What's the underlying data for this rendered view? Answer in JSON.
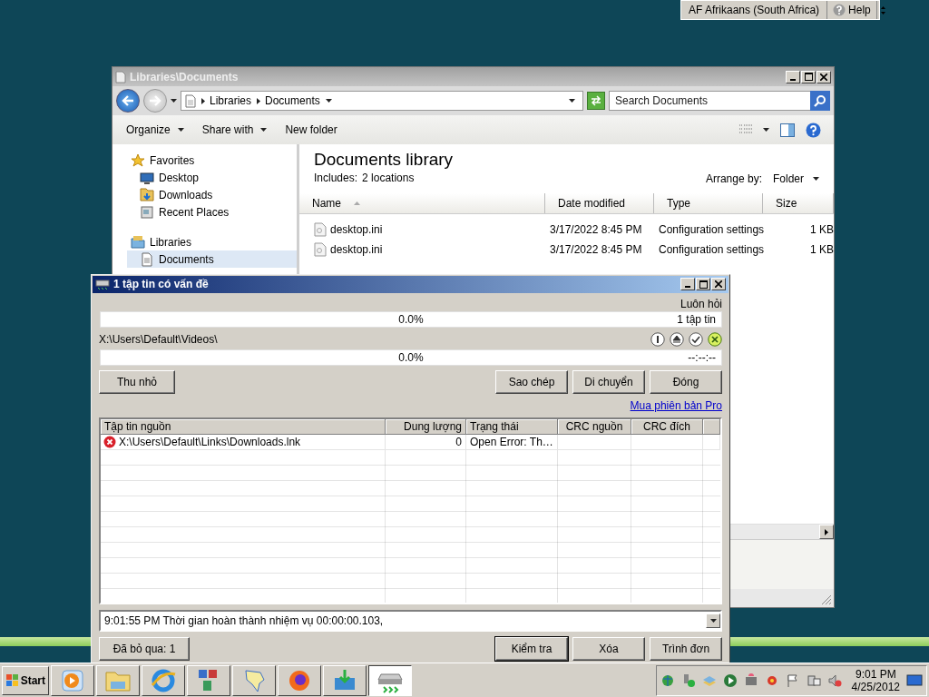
{
  "language_bar": {
    "language": "AF Afrikaans (South Africa)",
    "help": "Help"
  },
  "explorer": {
    "title": "Libraries\\Documents",
    "breadcrumbs": [
      "Libraries",
      "Documents"
    ],
    "search": {
      "placeholder": "Search Documents"
    },
    "toolbar": [
      {
        "label": "Organize",
        "dropdown": true
      },
      {
        "label": "Share with",
        "dropdown": true
      },
      {
        "label": "New folder",
        "dropdown": false
      }
    ],
    "nav": [
      {
        "label": "Favorites",
        "selected": false,
        "children": [
          {
            "label": "Desktop",
            "selected": false
          },
          {
            "label": "Downloads",
            "selected": false
          },
          {
            "label": "Recent Places",
            "selected": false
          }
        ]
      },
      {
        "label": "Libraries",
        "selected": false,
        "children": [
          {
            "label": "Documents",
            "selected": true
          }
        ]
      }
    ],
    "library_title": "Documents library",
    "includes_label": "Includes:",
    "includes_link": "2 locations",
    "arrange_label": "Arrange by:",
    "arrange_value": "Folder",
    "columns": [
      "Name",
      "Date modified",
      "Type",
      "Size"
    ],
    "rows": [
      {
        "name": "desktop.ini",
        "date": "3/17/2022 8:45 PM",
        "type": "Configuration settings",
        "size": "1 KB"
      },
      {
        "name": "desktop.ini",
        "date": "3/17/2022 8:45 PM",
        "type": "Configuration settings",
        "size": "1 KB"
      }
    ]
  },
  "dialog": {
    "title": "1 tập tin có vấn đề",
    "ask_label": "Luôn hỏi",
    "total_progress": {
      "percent": "0.0%",
      "count": "1 tập tin"
    },
    "current_path": "X:\\Users\\Default\\Videos\\",
    "file_progress": {
      "percent": "0.0%",
      "time": "--:--:--"
    },
    "minimize_button": "Thu nhỏ",
    "action_buttons": [
      "Sao chép",
      "Di chuyển",
      "Đóng"
    ],
    "pro_link": "Mua phiên bản Pro",
    "columns": [
      "Tập tin nguồn",
      "Dung lượng",
      "Trạng thái",
      "CRC nguồn",
      "CRC đích"
    ],
    "rows": [
      {
        "kind": "error",
        "source": "X:\\Users\\Default\\Links\\Downloads.lnk",
        "size": "0",
        "state": "Open Error: Th…"
      }
    ],
    "log": "9:01:55 PM Thời gian hoàn thành nhiệm vụ 00:00:00.103,",
    "skipped_button": "Đã bỏ qua: 1",
    "bottom_buttons": [
      {
        "label": "Kiểm tra",
        "focused": true
      },
      {
        "label": "Xóa",
        "focused": false
      },
      {
        "label": "Trình đơn",
        "focused": false
      }
    ]
  },
  "taskbar": {
    "start": "Start",
    "tasks": [
      {
        "selected": false
      },
      {
        "selected": false
      },
      {
        "selected": false
      },
      {
        "selected": false
      },
      {
        "selected": false
      },
      {
        "selected": false
      },
      {
        "selected": false
      },
      {
        "selected": true
      }
    ],
    "clock_time": "9:01 PM",
    "clock_date": "4/25/2012"
  }
}
